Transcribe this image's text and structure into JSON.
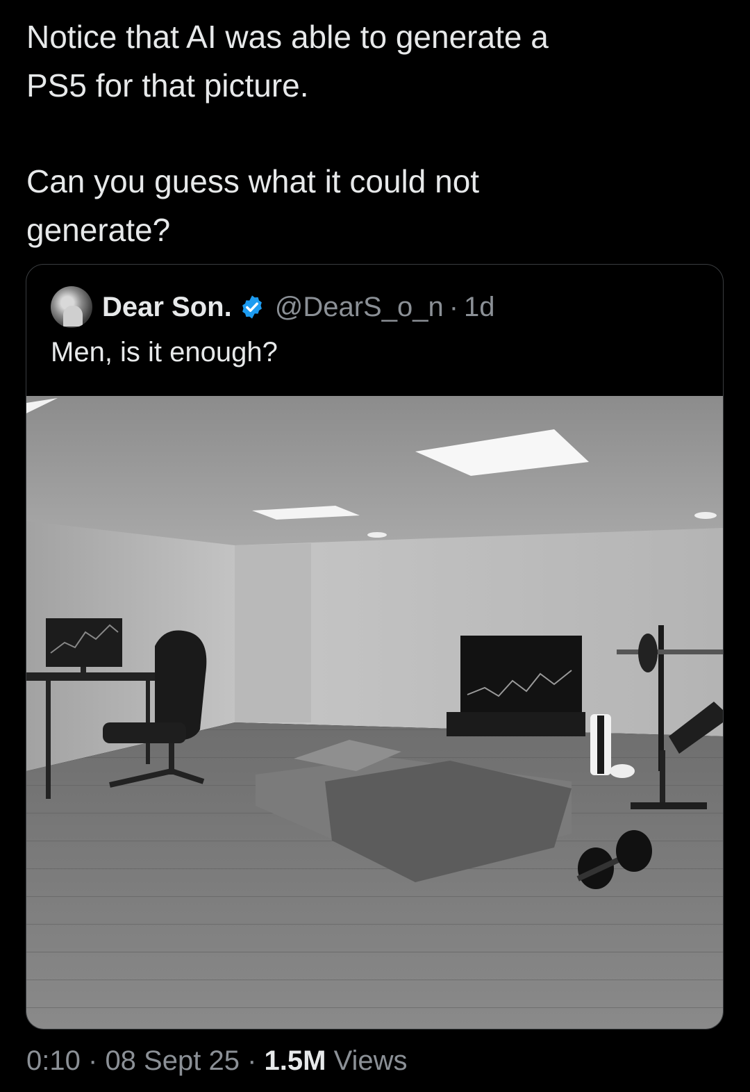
{
  "tweet": {
    "text_line1": "Notice that AI was able to generate a",
    "text_line2": "PS5 for that picture.",
    "text_line3": "Can you guess what it could not",
    "text_line4": "generate?"
  },
  "quote": {
    "display_name": "Dear Son.",
    "handle": "@DearS_o_n",
    "separator": "·",
    "age": "1d",
    "text": "Men, is it enough?",
    "image_icon": "room-photo"
  },
  "meta": {
    "time": "0:10",
    "sep1": "·",
    "date": "08 Sept 25",
    "sep2": "·",
    "views_count": "1.5M",
    "views_label": "Views"
  },
  "colors": {
    "background": "#000000",
    "text": "#e7e9ea",
    "muted": "#8b9096",
    "verified": "#1d9bf0"
  }
}
